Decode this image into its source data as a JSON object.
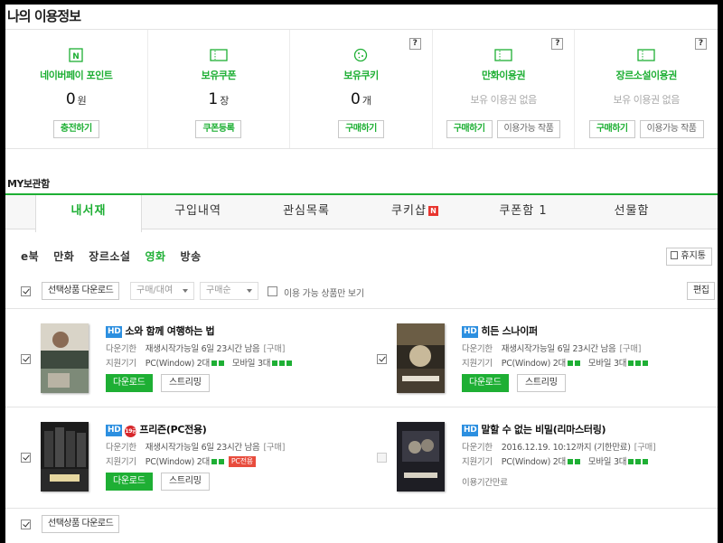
{
  "usage": {
    "title": "나의 이용정보",
    "help_mark": "?",
    "cards": [
      {
        "title": "네이버페이 포인트",
        "value": "0",
        "unit": "원",
        "buttons": [
          "충전하기"
        ]
      },
      {
        "title": "보유쿠폰",
        "value": "1",
        "unit": "장",
        "buttons": [
          "쿠폰등록"
        ]
      },
      {
        "title": "보유쿠키",
        "value": "0",
        "unit": "개",
        "buttons": [
          "구매하기"
        ]
      },
      {
        "title": "만화이용권",
        "empty": "보유 이용권 없음",
        "buttons": [
          "구매하기",
          "이용가능 작품"
        ]
      },
      {
        "title": "장르소설이용권",
        "empty": "보유 이용권 없음",
        "buttons": [
          "구매하기",
          "이용가능 작품"
        ]
      }
    ]
  },
  "locker": {
    "title": "MY보관함",
    "tabs": [
      "내서재",
      "구입내역",
      "관심목록",
      "쿠키샵",
      "쿠폰함 1",
      "선물함"
    ],
    "new_badge": "N",
    "subtabs": [
      "e북",
      "만화",
      "장르소설",
      "영화",
      "방송"
    ],
    "trash": "휴지통",
    "toolbar": {
      "download_selected": "선택상품 다운로드",
      "sort_type": "구매/대여",
      "sort_order": "구매순",
      "available_only": "이용 가능 상품만 보기",
      "edit": "편집"
    }
  },
  "labels": {
    "download_until": "다운기한",
    "devices": "지원기기",
    "download": "다운로드",
    "streaming": "스트리밍",
    "hd": "HD",
    "adult": "19금",
    "pc_only": "PC전용",
    "period_expired": "이용기간만료"
  },
  "items": [
    {
      "title": "소와 함께 여행하는 법",
      "deadline": "재생시작가능일 6일 23시간 남음",
      "purchase": "[구매]",
      "pc": "PC(Window) 2대",
      "mobile": "모바일 3대"
    },
    {
      "title": "히든 스나이퍼",
      "deadline": "재생시작가능일 6일 23시간 남음",
      "purchase": "[구매]",
      "pc": "PC(Window) 2대",
      "mobile": "모바일 3대"
    },
    {
      "title": "프리즌(PC전용)",
      "deadline": "재생시작가능일 6일 23시간 남음",
      "purchase": "[구매]",
      "pc": "PC(Window) 2대"
    },
    {
      "title": "말할 수 없는 비밀(리마스터링)",
      "deadline": "2016.12.19. 10:12까지 (기한만료)",
      "purchase": "[구매]",
      "pc": "PC(Window) 2대",
      "mobile": "모바일 3대"
    }
  ],
  "colors": {
    "accent": "#1eaf34",
    "hd": "#2c8fe0",
    "badge": "#e8352f"
  }
}
